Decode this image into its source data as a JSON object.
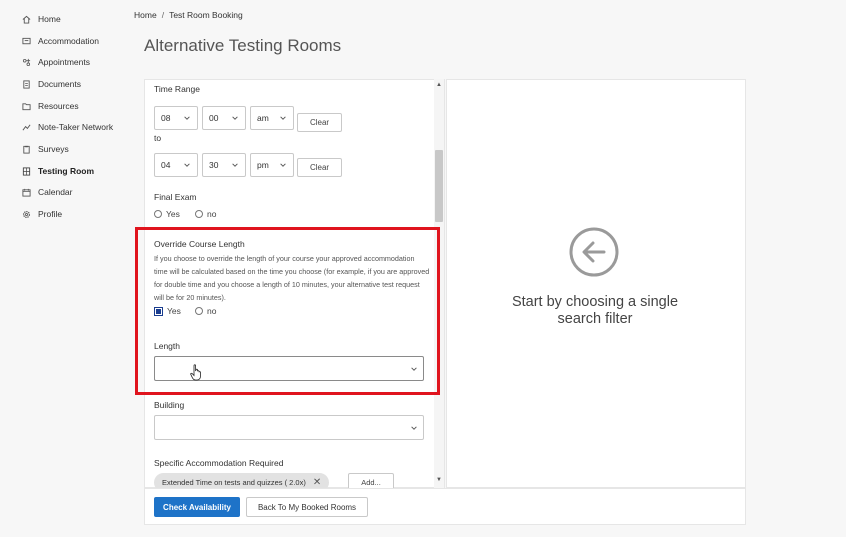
{
  "sidebar": {
    "items": [
      {
        "label": "Home",
        "icon": "home-icon"
      },
      {
        "label": "Accommodation",
        "icon": "accommodation-icon"
      },
      {
        "label": "Appointments",
        "icon": "appointments-icon"
      },
      {
        "label": "Documents",
        "icon": "documents-icon"
      },
      {
        "label": "Resources",
        "icon": "resources-icon"
      },
      {
        "label": "Note-Taker Network",
        "icon": "network-icon"
      },
      {
        "label": "Surveys",
        "icon": "surveys-icon"
      },
      {
        "label": "Testing Room",
        "icon": "testing-room-icon",
        "active": true
      },
      {
        "label": "Calendar",
        "icon": "calendar-icon"
      },
      {
        "label": "Profile",
        "icon": "gear-icon"
      }
    ]
  },
  "breadcrumb": {
    "home": "Home",
    "separator": "/",
    "current": "Test Room Booking"
  },
  "page": {
    "title": "Alternative Testing Rooms"
  },
  "form": {
    "time_range_label": "Time Range",
    "start": {
      "hour": "08",
      "minute": "00",
      "ampm": "am"
    },
    "to_label": "to",
    "end": {
      "hour": "04",
      "minute": "30",
      "ampm": "pm"
    },
    "clear_label": "Clear",
    "final_exam": {
      "label": "Final Exam",
      "yes": "Yes",
      "no": "no"
    },
    "override": {
      "label": "Override Course Length",
      "description": "If you choose to override the length of your course your approved accommodation time will be calculated based on the time you choose (for example, if you are approved for double time and you choose a length of 10 minutes, your alternative test request will be for 20 minutes).",
      "yes": "Yes",
      "no": "no",
      "selected": "yes"
    },
    "length_label": "Length",
    "length_value": "",
    "building_label": "Building",
    "building_value": "",
    "specific_accommodation_label": "Specific Accommodation Required",
    "accommodation_chip": "Extended Time on tests and quizzes ( 2.0x)",
    "add_label": "Add..."
  },
  "results": {
    "empty_text": "Start by choosing a single search filter"
  },
  "footer": {
    "check_availability": "Check Availability",
    "back_to_booked": "Back To My Booked Rooms"
  },
  "colors": {
    "highlight": "#e0141e",
    "primary": "#1e73c8"
  }
}
